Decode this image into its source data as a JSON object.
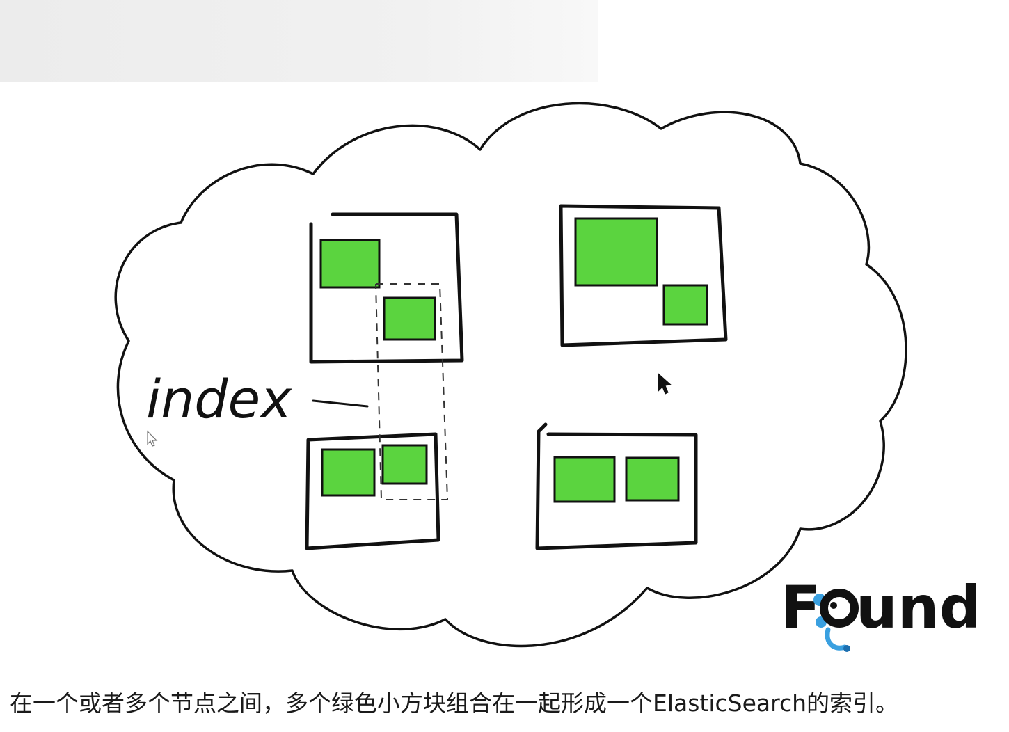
{
  "diagram": {
    "label": "index",
    "shard_color": "#5bd43f",
    "logo_text": "Found",
    "logo_accent_color": "#3aa0e0"
  },
  "caption": "在一个或者多个节点之间，多个绿色小方块组合在一起形成一个ElasticSearch的索引。"
}
